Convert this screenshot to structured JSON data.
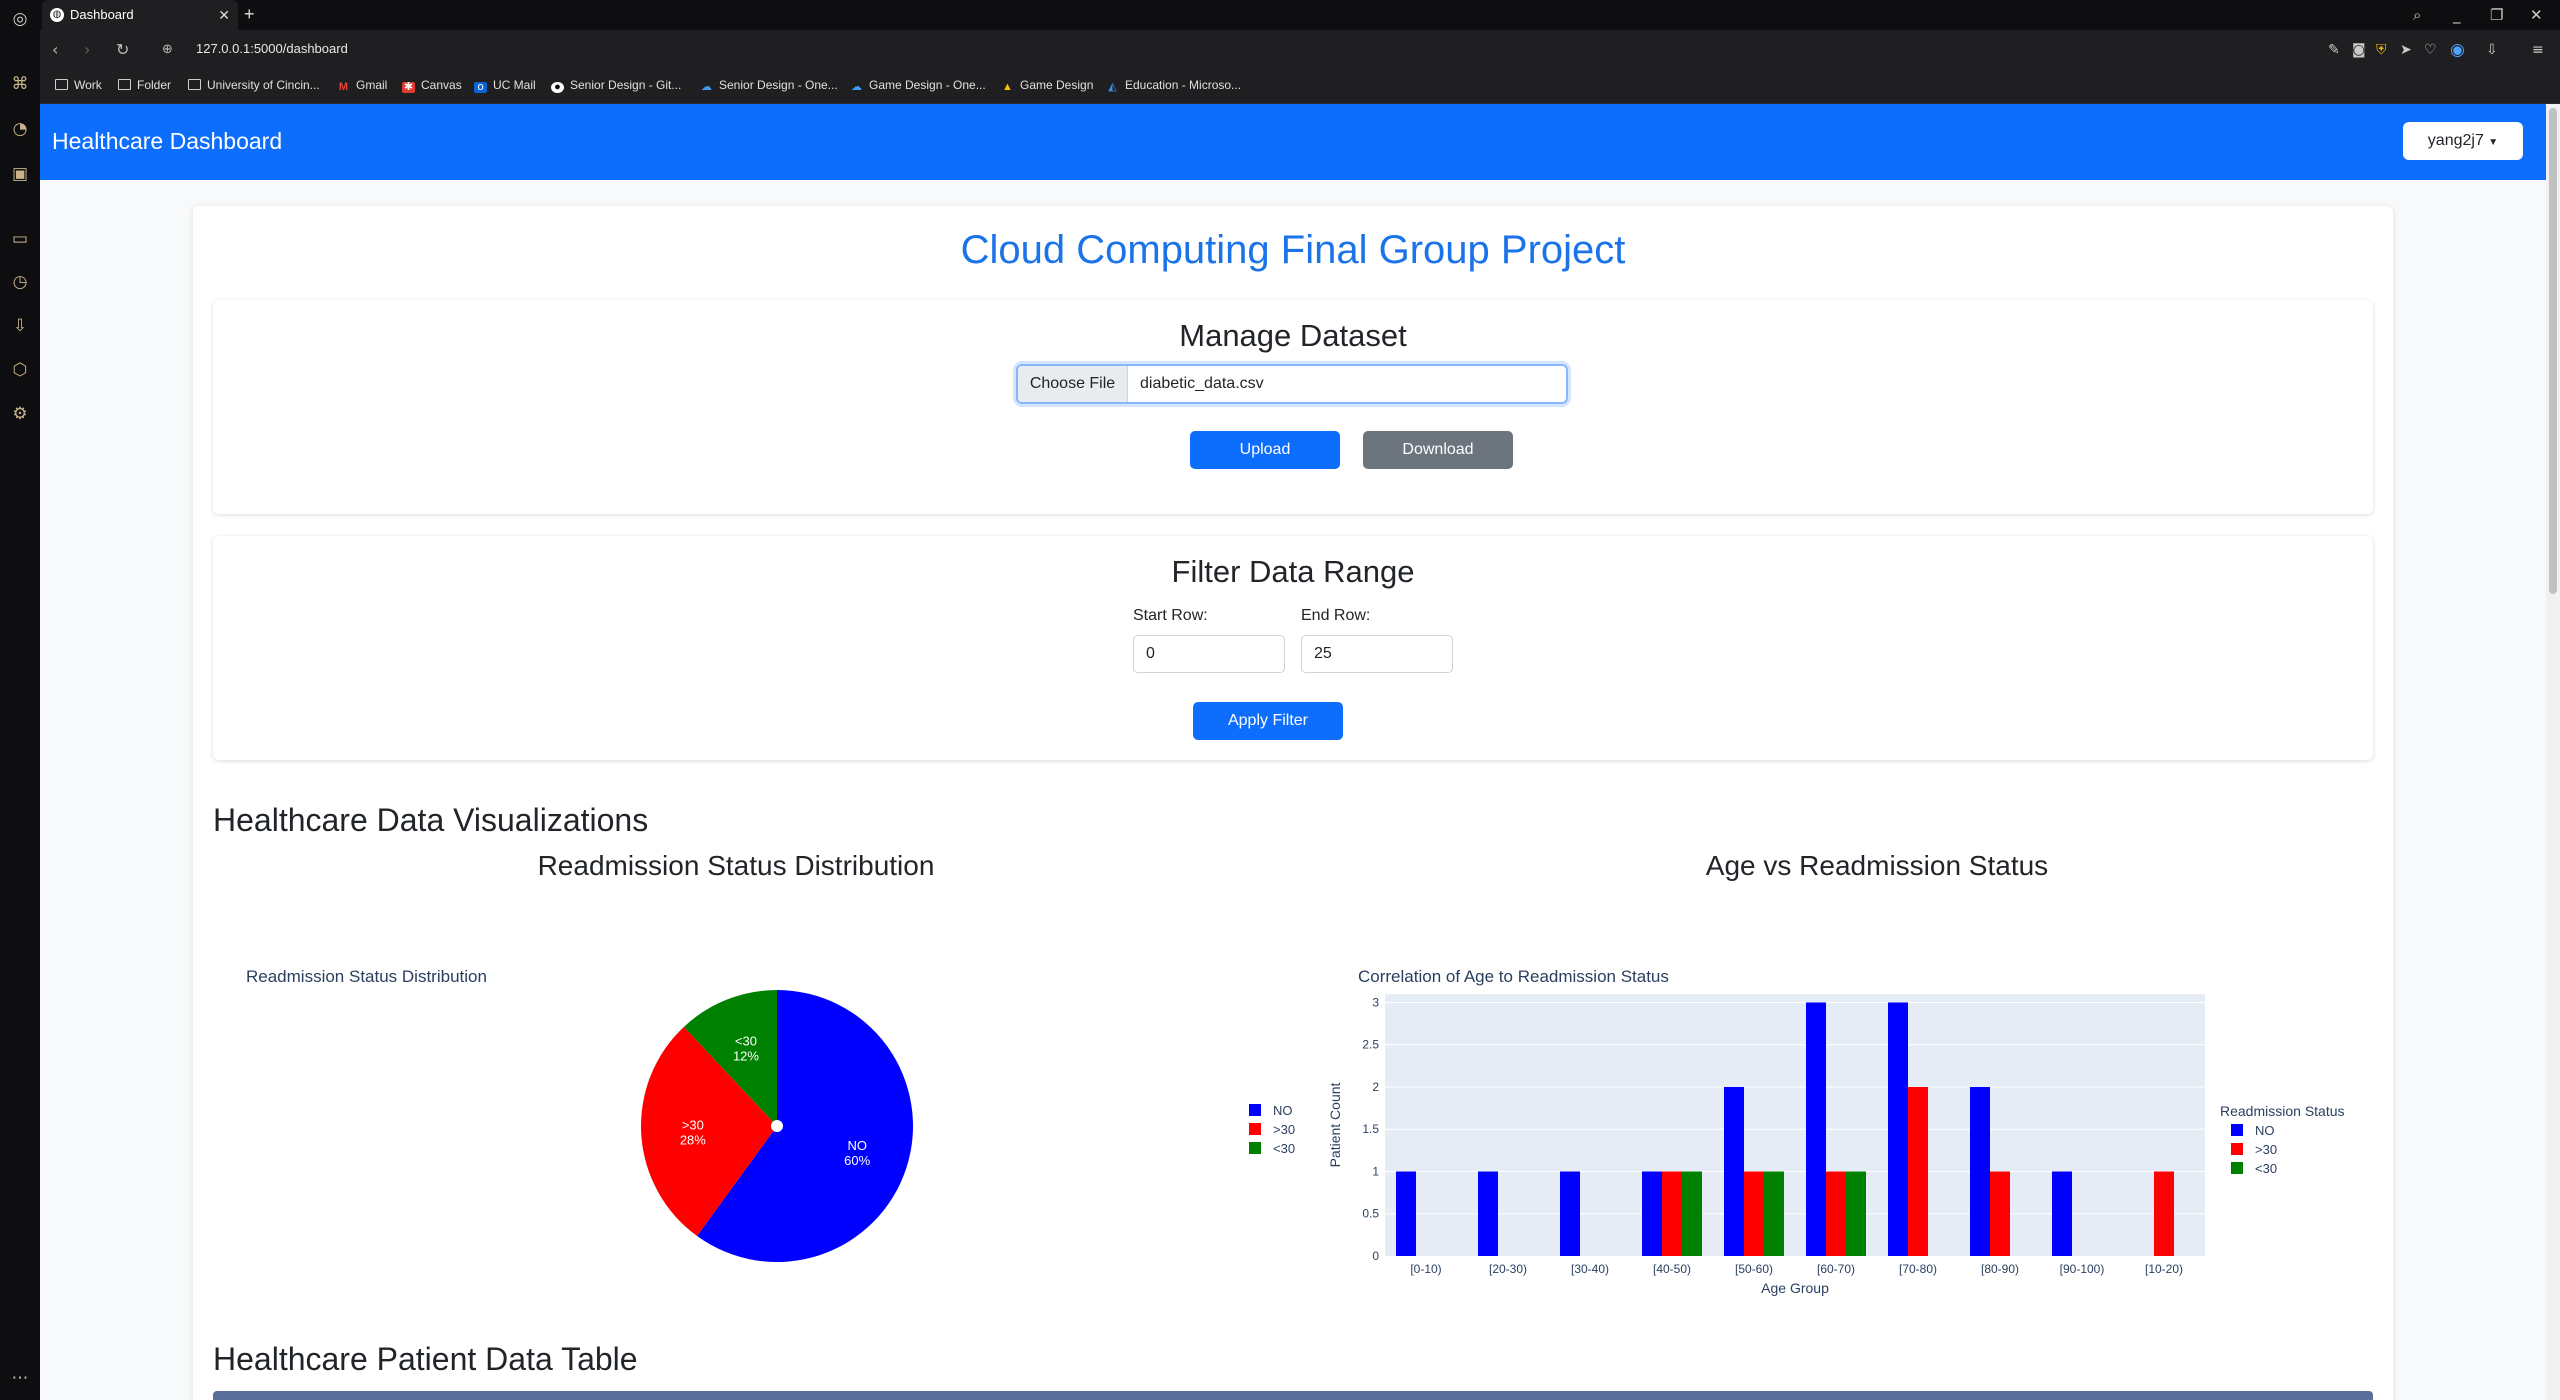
{
  "browser": {
    "tab_title": "Dashboard",
    "url": "127.0.0.1:5000/dashboard",
    "bookmarks": [
      "Work",
      "Folder",
      "University of Cincin...",
      "Gmail",
      "Canvas",
      "UC Mail",
      "Senior Design - Git...",
      "Senior Design - One...",
      "Game Design - One...",
      "Game Design",
      "Education - Microso..."
    ]
  },
  "navbar": {
    "brand": "Healthcare Dashboard",
    "user": "yang2j7"
  },
  "page": {
    "title": "Cloud Computing Final Group Project"
  },
  "manage": {
    "title": "Manage Dataset",
    "choose_file": "Choose File",
    "file_name": "diabetic_data.csv",
    "upload": "Upload",
    "download": "Download"
  },
  "filter": {
    "title": "Filter Data Range",
    "start_label": "Start Row:",
    "end_label": "End Row:",
    "start_value": "0",
    "end_value": "25",
    "apply": "Apply Filter"
  },
  "viz": {
    "heading": "Healthcare Data Visualizations",
    "left_title": "Readmission Status Distribution",
    "right_title": "Age vs Readmission Status"
  },
  "table": {
    "heading": "Healthcare Patient Data Table"
  },
  "colors": {
    "NO": "#0000ff",
    ">30": "#ff0000",
    "<30": "#008000",
    "primary": "#0d6efd"
  },
  "chart_data": [
    {
      "type": "pie",
      "title": "Readmission Status Distribution",
      "labels": [
        "NO",
        ">30",
        "<30"
      ],
      "values": [
        60,
        28,
        12
      ],
      "value_labels": [
        "60%",
        "28%",
        "12%"
      ],
      "legend": "right"
    },
    {
      "type": "bar",
      "title": "Correlation of Age to Readmission Status",
      "xlabel": "Age Group",
      "ylabel": "Patient Count",
      "legend_title": "Readmission Status",
      "legend": "right",
      "categories": [
        "[0-10)",
        "[20-30)",
        "[30-40)",
        "[40-50)",
        "[50-60)",
        "[60-70)",
        "[70-80)",
        "[80-90)",
        "[90-100)",
        "[10-20)"
      ],
      "ylim": [
        0,
        3.1
      ],
      "yticks": [
        0,
        0.5,
        1,
        1.5,
        2,
        2.5,
        3
      ],
      "ytick_labels": [
        "0",
        "0.5",
        "1",
        "1.5",
        "2",
        "2.5",
        "3"
      ],
      "series": [
        {
          "name": "NO",
          "values": [
            1,
            1,
            1,
            1,
            2,
            3,
            3,
            2,
            1,
            0
          ]
        },
        {
          "name": ">30",
          "values": [
            0,
            0,
            0,
            1,
            1,
            1,
            2,
            1,
            0,
            1
          ]
        },
        {
          "name": "<30",
          "values": [
            0,
            0,
            0,
            1,
            1,
            1,
            0,
            0,
            0,
            0
          ]
        }
      ],
      "grid": true
    }
  ]
}
